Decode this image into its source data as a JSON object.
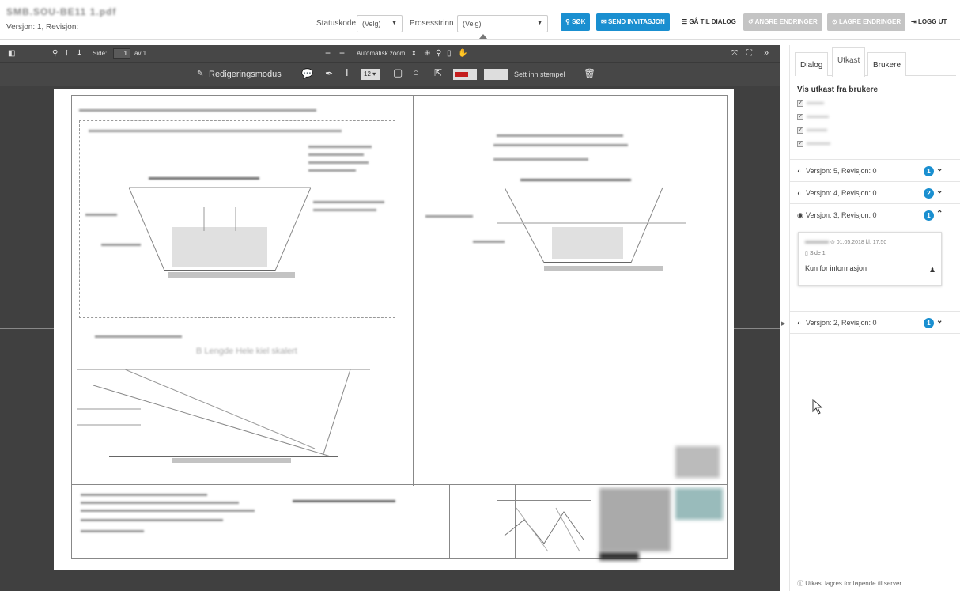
{
  "header": {
    "doc_title": "SMB.SOU-BE11 1.pdf",
    "version_line": "Versjon: 1, Revisjon:",
    "statuskode_label": "Statuskode",
    "statuskode_value": "(Velg)",
    "prosesstrinn_label": "Prosesstrinn",
    "prosesstrinn_value": "(Velg)",
    "buttons": {
      "search": "SØK",
      "send_invite": "SEND INVITASJON",
      "go_dialog": "GÅ TIL DIALOG",
      "undo": "ANGRE ENDRINGER",
      "save": "LAGRE ENDRINGER",
      "logout": "LOGG UT"
    },
    "colors": {
      "primary": "#1a8fd0",
      "disabled": "#c4c4c4"
    }
  },
  "viewer": {
    "page_label": "Side:",
    "page_number": "1",
    "page_total": "av 1",
    "zoom_value": "Automatisk zoom",
    "edit_mode_label": "Redigeringsmodus",
    "font_size": "12",
    "stamp_label": "Sett inn stempel",
    "annotation_color": "#c41d1d",
    "icons": [
      "sidebar-toggle-icon",
      "search-icon",
      "prev-page-icon",
      "next-page-icon",
      "zoom-out-icon",
      "zoom-in-icon",
      "zoom-icon",
      "search-doc-icon",
      "file-icon",
      "hand-icon",
      "fullscreen-icon",
      "expand-icon",
      "more-icon",
      "pencil-icon",
      "comment-icon",
      "pen-icon",
      "text-cursor-icon",
      "rectangle-icon",
      "circle-icon",
      "share-icon",
      "trash-icon"
    ]
  },
  "drawing": {
    "caption_bottom": "B Lengde Hele kiel skalert"
  },
  "panel": {
    "tabs": [
      "Dialog",
      "Utkast",
      "Brukere"
    ],
    "active_tab": "Utkast",
    "section_title": "Vis utkast fra brukere",
    "users_count_checked": 4,
    "versions": [
      {
        "label": "Versjon: 5, Revisjon: 0",
        "badge": "1",
        "expanded": false
      },
      {
        "label": "Versjon: 4, Revisjon: 0",
        "badge": "2",
        "expanded": false
      },
      {
        "label": "Versjon: 3, Revisjon: 0",
        "badge": "1",
        "expanded": true
      },
      {
        "label": "Versjon: 2, Revisjon: 0",
        "badge": "1",
        "expanded": false
      }
    ],
    "comment": {
      "timestamp": "01.05.2018 kl. 17:50",
      "page": "Side 1",
      "text": "Kun for informasjon"
    },
    "footer_note": "Utkast lagres fortløpende til server."
  }
}
